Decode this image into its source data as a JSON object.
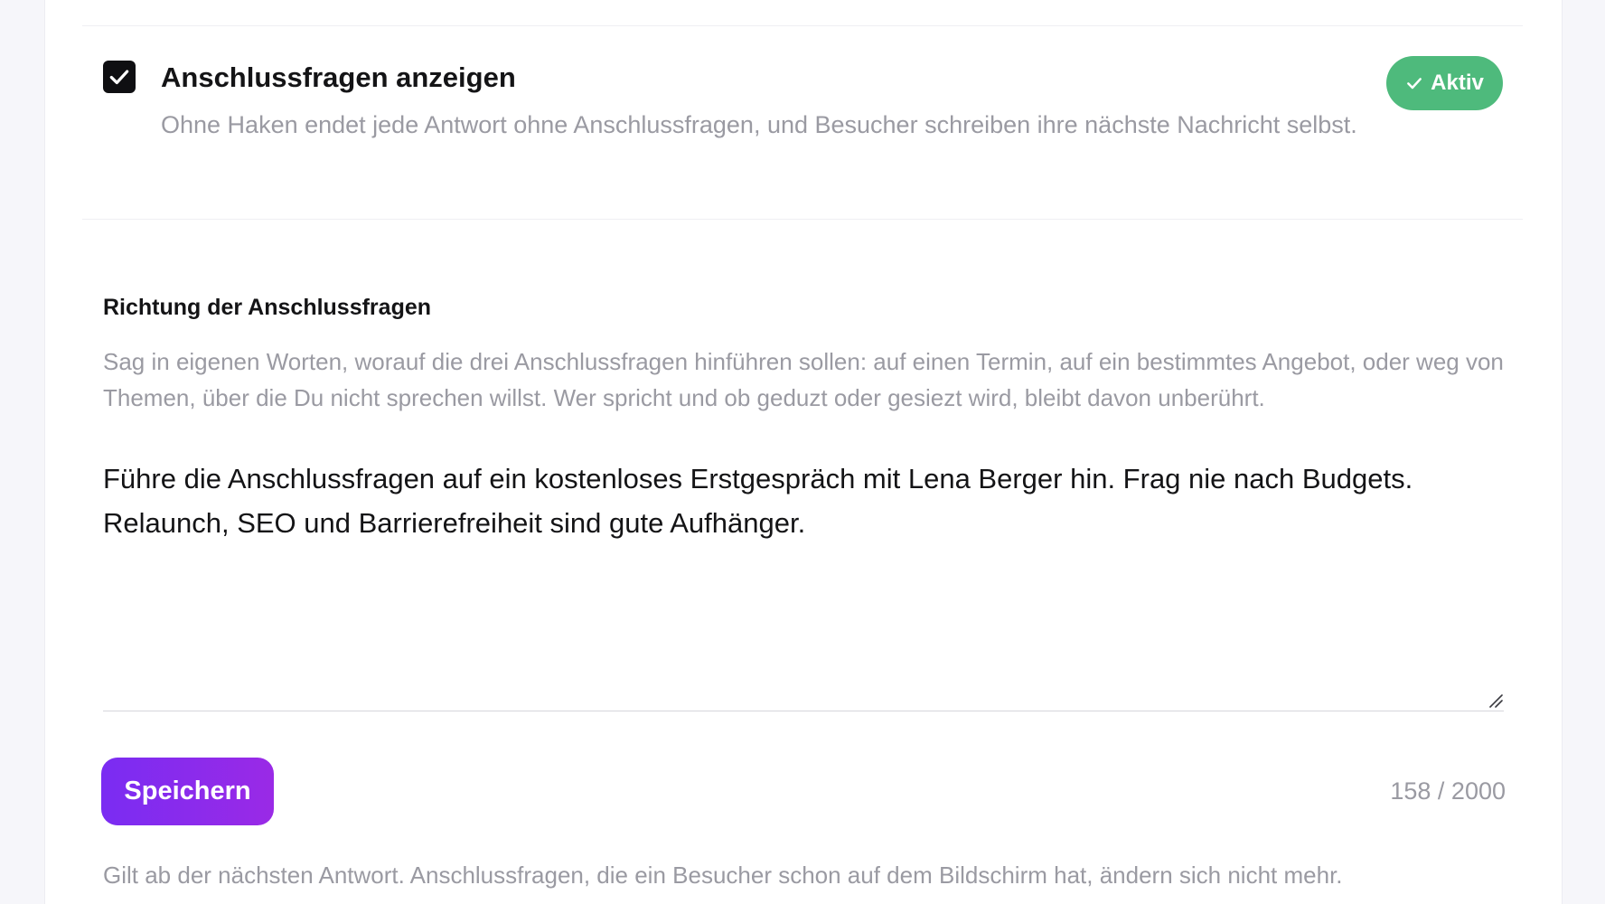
{
  "followups_toggle": {
    "title": "Anschlussfragen anzeigen",
    "description": "Ohne Haken endet jede Antwort ohne Anschlussfragen, und Besucher schreiben ihre nächste Nachricht selbst.",
    "checked": true,
    "status_label": "Aktiv",
    "status_icon": "check-icon",
    "status_color": "#4eba7c"
  },
  "direction": {
    "label": "Richtung der Anschlussfragen",
    "help": "Sag in eigenen Worten, worauf die drei Anschlussfragen hinführen sollen: auf einen Termin, auf ein bestimmtes Angebot, oder weg von Themen, über die Du nicht sprechen willst. Wer spricht und ob geduzt oder gesiezt wird, bleibt davon unberührt.",
    "value": "Führe die Anschlussfragen auf ein kostenloses Erstgespräch mit Lena Berger hin. Frag nie nach Budgets. Relaunch, SEO und Barrierefreiheit sind gute Aufhänger.",
    "char_count": "158 / 2000"
  },
  "actions": {
    "save_label": "Speichern",
    "save_color": "#7a2cf2"
  },
  "footnote": "Gilt ab der nächsten Antwort. Anschlussfragen, die ein Besucher schon auf dem Bildschirm hat, ändern sich nicht mehr."
}
